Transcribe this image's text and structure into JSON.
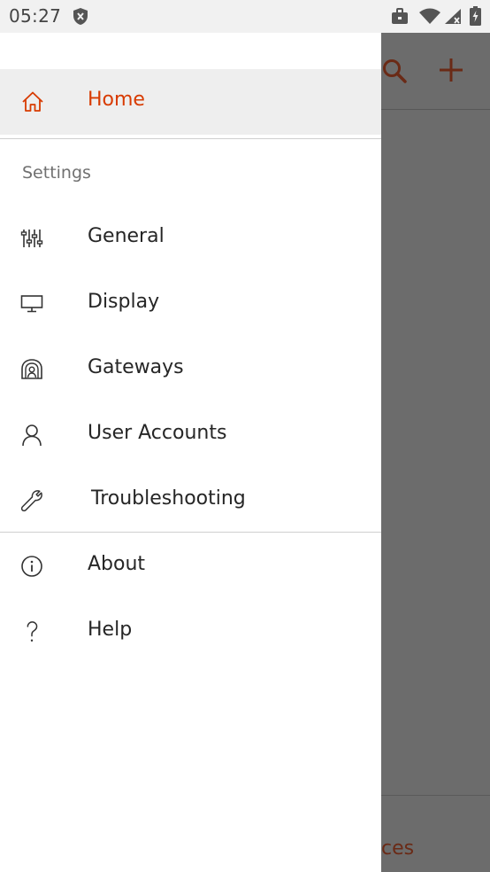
{
  "status_bar": {
    "time": "05:27",
    "icons": [
      "shield-icon",
      "briefcase-icon",
      "wifi-icon",
      "signal-icon",
      "battery-icon"
    ]
  },
  "drawer": {
    "home_label": "Home",
    "settings_header": "Settings",
    "settings_items": [
      {
        "label": "General",
        "icon": "sliders-icon"
      },
      {
        "label": "Display",
        "icon": "monitor-icon"
      },
      {
        "label": "Gateways",
        "icon": "gateway-icon"
      },
      {
        "label": "User Accounts",
        "icon": "user-icon"
      },
      {
        "label": "Troubleshooting",
        "icon": "wrench-icon"
      }
    ],
    "other_items": [
      {
        "label": "About",
        "icon": "info-icon"
      },
      {
        "label": "Help",
        "icon": "question-icon"
      }
    ]
  },
  "background_app": {
    "bottom_nav_text": "ces"
  },
  "colors": {
    "accent": "#d83b01",
    "scrim": "#6c6c6c",
    "home_highlight": "#eeeeee"
  }
}
